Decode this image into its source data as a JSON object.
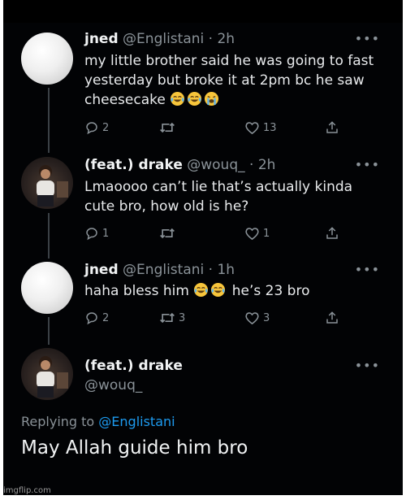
{
  "tweets": [
    {
      "name": "jned",
      "handle": "@Englistani",
      "time": "· 2h",
      "text": "my little brother said he was going to fast yesterday but broke it at 2pm bc he saw cheesecake",
      "emojis": [
        "face-with-tears-of-joy",
        "face-with-tears-of-joy",
        "loudly-crying-face"
      ],
      "replies": "2",
      "retweets": "",
      "likes": "13"
    },
    {
      "name": "(feat.) drake",
      "handle": "@wouq_",
      "time": "· 2h",
      "text": "Lmaoooo can’t lie that’s actually kinda cute bro, how old is he?",
      "replies": "1",
      "retweets": "",
      "likes": "1"
    },
    {
      "name": "jned",
      "handle": "@Englistani",
      "time": "· 1h",
      "text_before": "haha bless him",
      "emojis": [
        "face-with-tears-of-joy",
        "face-with-tears-of-joy"
      ],
      "text_after": "he’s 23 bro",
      "replies": "2",
      "retweets": "3",
      "likes": "3"
    }
  ],
  "main_tweet": {
    "name": "(feat.) drake",
    "handle": "@wouq_",
    "replying_prefix": "Replying to",
    "replying_to": "@Englistani",
    "text": "May Allah guide him bro"
  },
  "more_label": "•••",
  "watermark": "imgflip.com",
  "colors": {
    "background": "#020305",
    "text": "#e8eaec",
    "muted": "#8a9298",
    "link": "#1d9bf0"
  },
  "icons": [
    "reply-icon",
    "retweet-icon",
    "like-icon",
    "share-icon",
    "more-icon"
  ]
}
